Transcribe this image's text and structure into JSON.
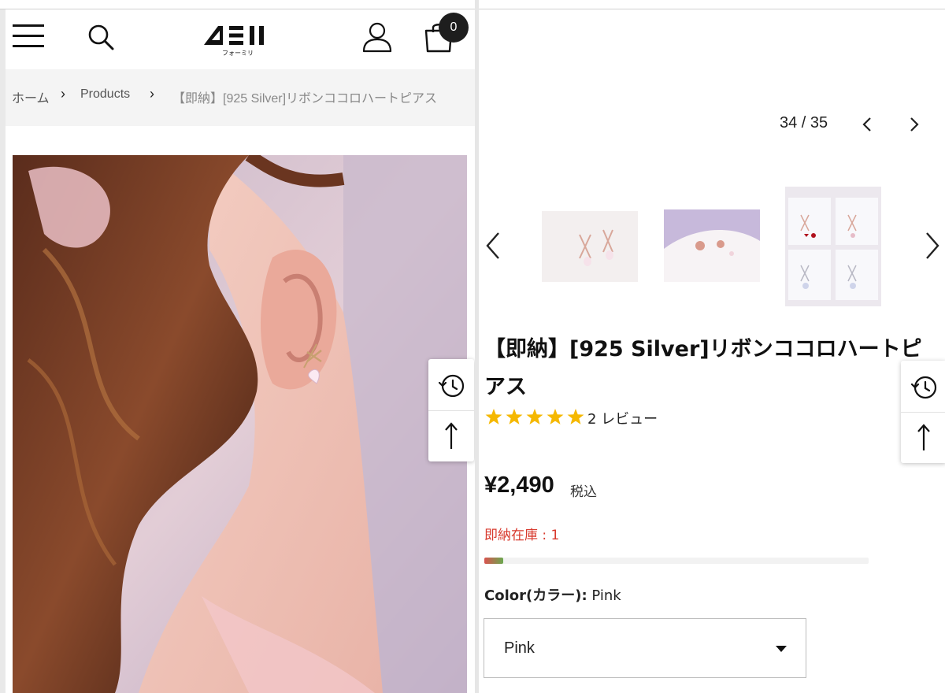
{
  "header": {
    "logo_text": "4ΞΙΙ",
    "logo_sub": "フォーミリ",
    "cart_count": "0"
  },
  "breadcrumb": {
    "home": "ホーム",
    "products": "Products",
    "current": "【即納】[925 Silver]リボンココロハートピアス"
  },
  "gallery": {
    "counter": "34 / 35"
  },
  "product": {
    "title": "【即納】[925 Silver]リボンココロハートピアス",
    "rating": 5,
    "review_text": "2 レビュー",
    "price": "¥2,490",
    "tax_label": "税込",
    "stock_text": "即納在庫 : 1",
    "stock_level": 0.05,
    "option_label": "Color(カラー):",
    "option_value": "Pink",
    "select_value": "Pink"
  },
  "colors": {
    "star": "#f5b800",
    "stock_text": "#d83a2e",
    "badge": "#1e1e1e"
  },
  "icons": [
    "menu-icon",
    "search-icon",
    "user-icon",
    "cart-icon",
    "history-icon",
    "arrow-up-icon",
    "chevron-left-icon",
    "chevron-right-icon",
    "star-icon",
    "caret-down-icon"
  ]
}
